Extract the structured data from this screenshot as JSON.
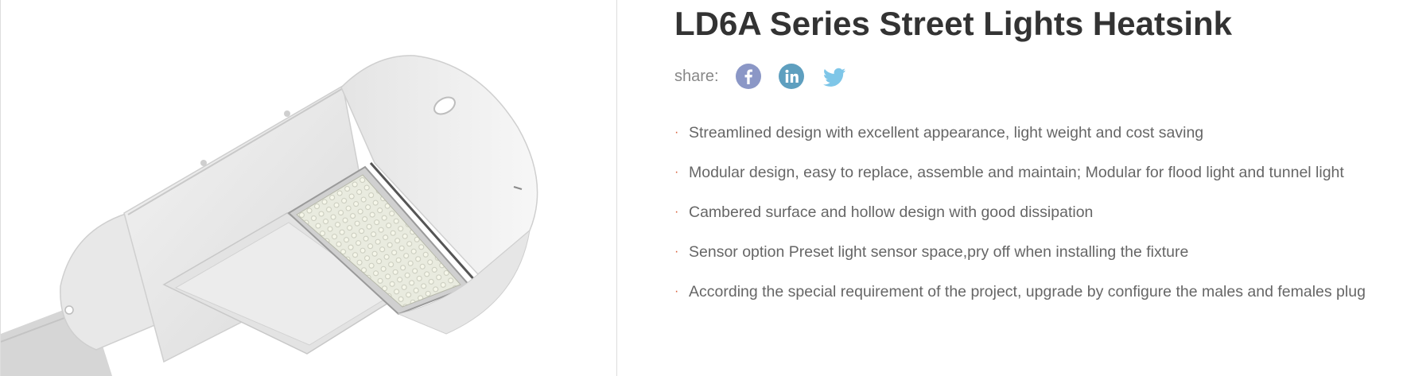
{
  "product": {
    "title": "LD6A Series Street Lights Heatsink",
    "image_icon": "street-light-image"
  },
  "share": {
    "label": "share:",
    "networks": [
      {
        "name": "facebook",
        "icon": "facebook-icon",
        "color": "#8b97c6"
      },
      {
        "name": "linkedin",
        "icon": "linkedin-icon",
        "color": "#5e9fbf"
      },
      {
        "name": "twitter",
        "icon": "twitter-icon",
        "color": "#7ec6e8"
      }
    ]
  },
  "features": [
    "Streamlined design with excellent appearance, light weight and cost saving",
    "Modular design, easy to replace, assemble and maintain; Modular for flood light and tunnel light",
    "Cambered surface and hollow design with good dissipation",
    "Sensor option Preset light sensor space,pry off when installing the fixture",
    "According the special requirement of the project, upgrade by configure the males and females plug"
  ],
  "colors": {
    "title": "#333333",
    "text": "#666666",
    "bullet": "#d9603b",
    "divider": "#dddddd"
  }
}
